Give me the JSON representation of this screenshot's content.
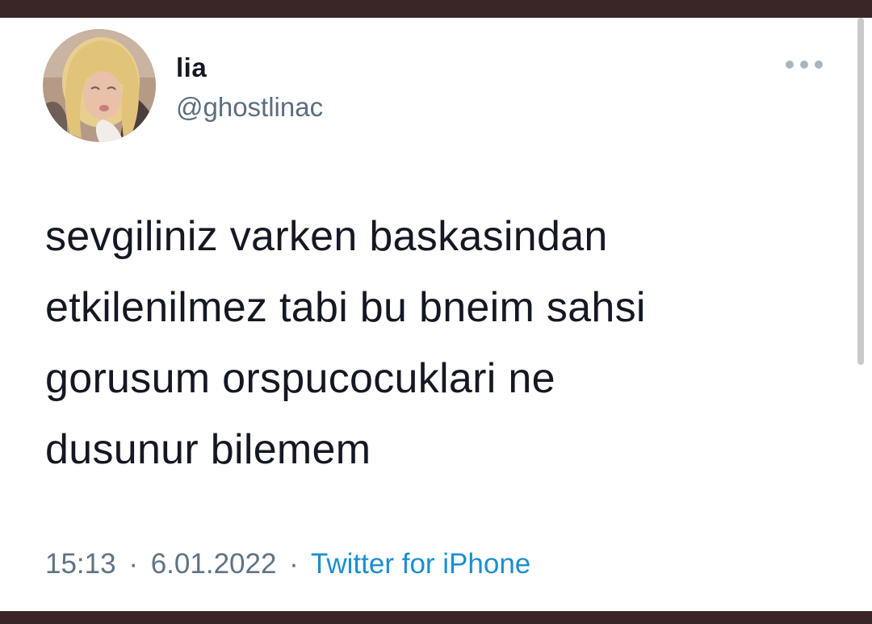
{
  "tweet": {
    "display_name": "lia",
    "handle": "@ghostlinac",
    "text": "sevgiliniz varken baskasindan\netkilenilmez tabi bu bneim sahsi\ngorusum orspucocuklari ne\ndusunur bilemem",
    "time": "15:13",
    "date": "6.01.2022",
    "separator": "·",
    "source": "Twitter for iPhone"
  },
  "icons": {
    "avatar": "profile-photo",
    "more": "more-options-icon"
  },
  "colors": {
    "text": "#141823",
    "secondary": "#5f7384",
    "link": "#1b8ed1",
    "frame": "#3a2626"
  }
}
